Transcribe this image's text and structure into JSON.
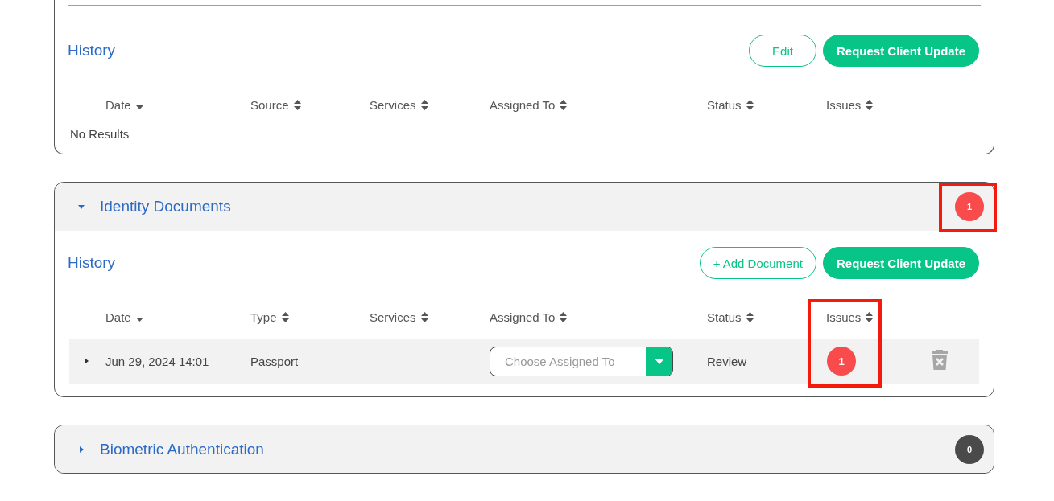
{
  "sections": [
    {
      "kind": "plain",
      "history_title": "History",
      "buttons": [
        {
          "label": "Edit",
          "kind": "outline"
        },
        {
          "label": "Request Client Update",
          "kind": "solid"
        }
      ],
      "columns": [
        {
          "label": "Date",
          "kind": "descending",
          "highlighted": false
        },
        {
          "label": "Source",
          "kind": "sortable",
          "highlighted": false
        },
        {
          "label": "Services",
          "kind": "sortable",
          "highlighted": false
        },
        {
          "label": "Assigned To",
          "kind": "sortable",
          "highlighted": false
        },
        {
          "label": "Status",
          "kind": "sortable",
          "highlighted": false
        },
        {
          "label": "Issues",
          "kind": "sortable",
          "highlighted": false
        }
      ],
      "empty_text": "No Results"
    },
    {
      "kind": "accordion",
      "title": "Identity Documents",
      "expanded": true,
      "count": "1",
      "color": "#f94a4c",
      "highlighted": true,
      "history_title": "History",
      "buttons": [
        {
          "label": "+ Add Document",
          "kind": "outline"
        },
        {
          "label": "Request Client Update",
          "kind": "solid"
        }
      ],
      "columns": [
        {
          "label": "Date",
          "kind": "descending",
          "highlighted": false
        },
        {
          "label": "Type",
          "kind": "sortable",
          "highlighted": false
        },
        {
          "label": "Services",
          "kind": "sortable",
          "highlighted": false
        },
        {
          "label": "Assigned To",
          "kind": "sortable",
          "highlighted": false
        },
        {
          "label": "Status",
          "kind": "sortable",
          "highlighted": false
        },
        {
          "label": "Issues",
          "kind": "sortable",
          "highlighted": true
        }
      ],
      "rows": [
        {
          "expanded": false,
          "date": "Jun 29, 2024 14:01",
          "type": "Passport",
          "assigned_placeholder": "Choose Assigned To",
          "status": "Review",
          "issues": "1"
        }
      ]
    },
    {
      "kind": "accordion",
      "title": "Biometric Authentication",
      "expanded": false,
      "count": "0",
      "color": "#4a4a4a",
      "highlighted": false
    }
  ]
}
